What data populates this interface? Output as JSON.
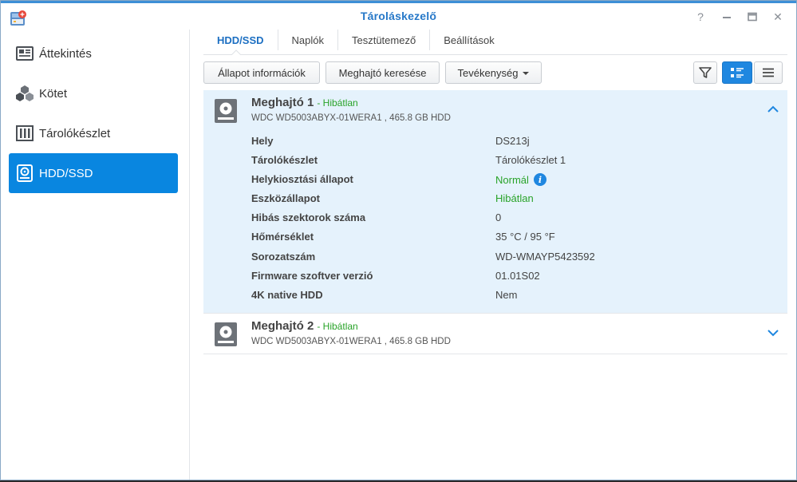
{
  "window": {
    "title": "Tároláskezelő",
    "controls": [
      "help",
      "minimize",
      "maximize",
      "close"
    ],
    "help_glyph": "?",
    "close_glyph": "✕"
  },
  "colors": {
    "accent": "#0986e0",
    "title": "#2678c8",
    "status_ok": "#29a329",
    "selected_row": "#e5f2fc"
  },
  "sidebar": {
    "items": [
      {
        "label": "Áttekintés",
        "icon": "overview-icon",
        "active": false
      },
      {
        "label": "Kötet",
        "icon": "volume-icon",
        "active": false
      },
      {
        "label": "Tárolókészlet",
        "icon": "storage-pool-icon",
        "active": false
      },
      {
        "label": "HDD/SSD",
        "icon": "hdd-icon",
        "active": true
      }
    ]
  },
  "tabs": [
    {
      "label": "HDD/SSD",
      "active": true
    },
    {
      "label": "Naplók",
      "active": false
    },
    {
      "label": "Tesztütemező",
      "active": false
    },
    {
      "label": "Beállítások",
      "active": false
    }
  ],
  "toolbar": {
    "status_info": "Állapot információk",
    "locate_drive": "Meghajtó keresése",
    "action": "Tevékenység",
    "icons": [
      "filter-icon",
      "detail-view-icon",
      "list-view-icon"
    ]
  },
  "drives": [
    {
      "name": "Meghajtó 1",
      "status": "- Hibátlan",
      "model": "WDC WD5003ABYX-01WERA1 , 465.8 GB HDD",
      "expanded": true,
      "props": [
        {
          "key": "Hely",
          "value": "DS213j"
        },
        {
          "key": "Tárolókészlet",
          "value": "Tárolókészlet 1"
        },
        {
          "key": "Helykiosztási állapot",
          "value": "Normál",
          "green": true,
          "info": true
        },
        {
          "key": "Eszközállapot",
          "value": "Hibátlan",
          "green": true
        },
        {
          "key": "Hibás szektorok száma",
          "value": "0"
        },
        {
          "key": "Hőmérséklet",
          "value": "35 °C / 95 °F"
        },
        {
          "key": "Sorozatszám",
          "value": "WD-WMAYP5423592"
        },
        {
          "key": "Firmware szoftver verzió",
          "value": "01.01S02"
        },
        {
          "key": "4K native HDD",
          "value": "Nem"
        }
      ]
    },
    {
      "name": "Meghajtó 2",
      "status": "- Hibátlan",
      "model": "WDC WD5003ABYX-01WERA1 , 465.8 GB HDD",
      "expanded": false
    }
  ],
  "info_glyph": "i"
}
